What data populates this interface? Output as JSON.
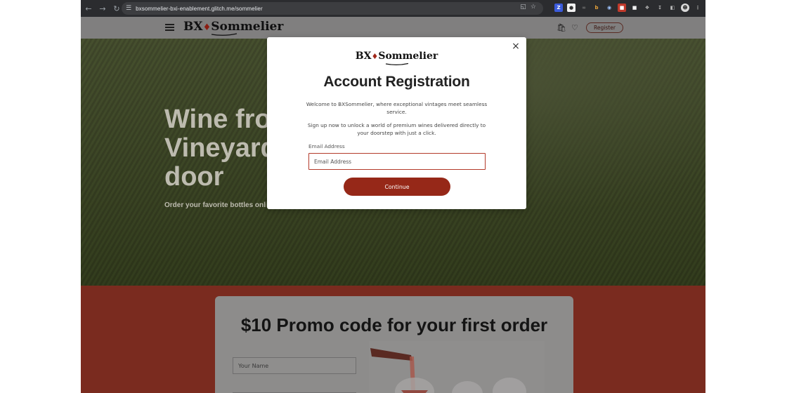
{
  "browser": {
    "url": "bxsommelier-bxi-enablement.glitch.me/sommelier",
    "back_icon": "arrow-left-icon",
    "forward_icon": "arrow-right-icon",
    "reload_icon": "reload-icon"
  },
  "header": {
    "logo_left": "BX",
    "logo_right": "Sommelier",
    "register_label": "Register"
  },
  "hero": {
    "title_line1": "Wine fro",
    "title_line2": "Vineyard",
    "title_line3": "door",
    "subtitle": "Order your favorite bottles onli"
  },
  "promo": {
    "title": "$10 Promo code for your first order",
    "name_placeholder": "Your Name"
  },
  "modal": {
    "logo_left": "BX",
    "logo_right": "Sommelier",
    "title": "Account Registration",
    "paragraph1": "Welcome to BXSommelier, where exceptional vintages meet seamless service.",
    "paragraph2": "Sign up now to unlock a world of premium wines delivered directly to your doorstep with just a click.",
    "email_label": "Email Address",
    "email_placeholder": "Email Address",
    "continue_label": "Continue",
    "close_symbol": "×"
  },
  "colors": {
    "brand_red": "#962818",
    "promo_band": "#7a2b1f"
  }
}
